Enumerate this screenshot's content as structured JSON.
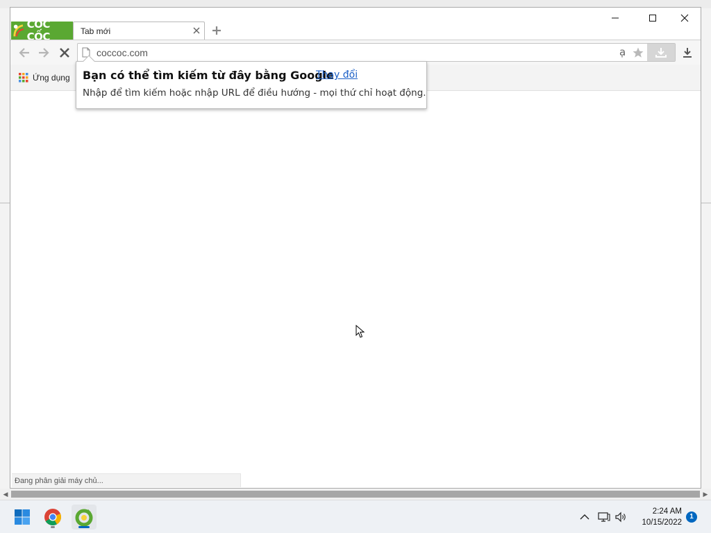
{
  "browser": {
    "brand_text": "CỐC CỐC",
    "tab_title": "Tab mới",
    "url": "coccoc.com",
    "translate_glyph": "ạ",
    "bookmarks_apps_label": "Ứng dụng",
    "status_text": "Đang phân giải máy chủ..."
  },
  "popup": {
    "title": "Bạn có thể tìm kiếm từ đây bằng Google",
    "change_link": "Thay đổi",
    "description": "Nhập để tìm kiếm hoặc nhập URL để điều hướng - mọi thứ chỉ hoạt động."
  },
  "taskbar": {
    "time": "2:24 AM",
    "date": "10/15/2022",
    "notification_count": "1"
  },
  "colors": {
    "brand_green": "#5aa832",
    "link_blue": "#1a5fc7",
    "windows_blue": "#0067c0"
  }
}
